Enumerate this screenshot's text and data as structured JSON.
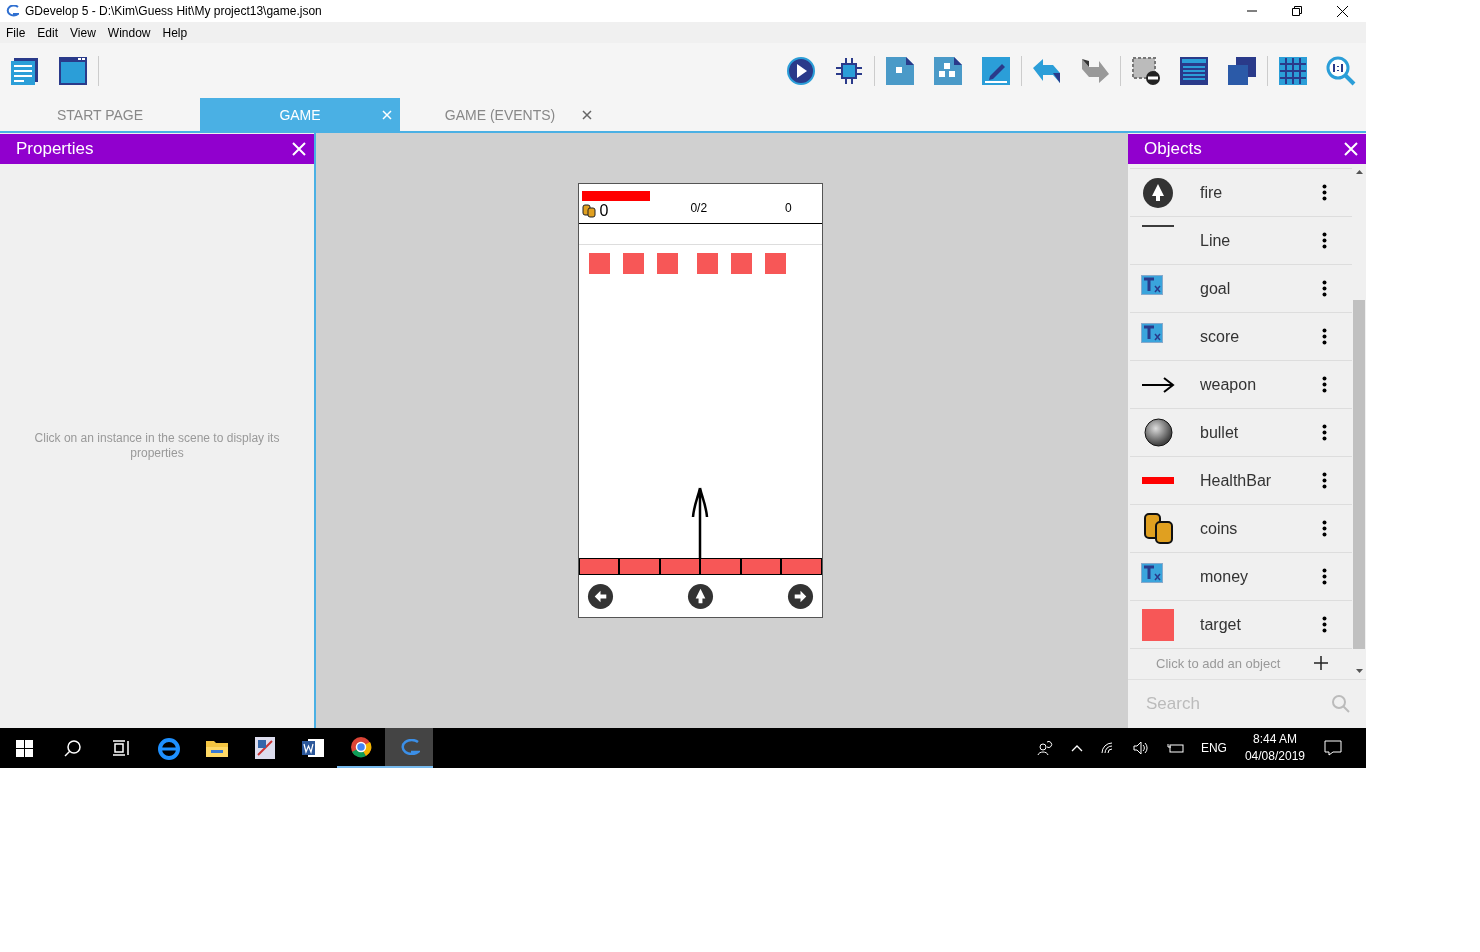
{
  "window": {
    "title": "GDevelop 5 - D:\\Kim\\Guess Hit\\My project13\\game.json"
  },
  "menu": [
    "File",
    "Edit",
    "View",
    "Window",
    "Help"
  ],
  "tabs": [
    {
      "label": "START PAGE",
      "selected": false,
      "closable": false
    },
    {
      "label": "GAME",
      "selected": true,
      "closable": true
    },
    {
      "label": "GAME (EVENTS)",
      "selected": false,
      "closable": true
    }
  ],
  "properties": {
    "title": "Properties",
    "hint": "Click on an instance in the scene to display its properties"
  },
  "scene": {
    "hud": {
      "coins": "0",
      "goal": "0/2",
      "score": "0"
    }
  },
  "objects": {
    "title": "Objects",
    "items": [
      {
        "name": "fire",
        "kind": "button"
      },
      {
        "name": "Line",
        "kind": "line"
      },
      {
        "name": "goal",
        "kind": "text"
      },
      {
        "name": "score",
        "kind": "text"
      },
      {
        "name": "weapon",
        "kind": "arrow"
      },
      {
        "name": "bullet",
        "kind": "ball"
      },
      {
        "name": "HealthBar",
        "kind": "bar"
      },
      {
        "name": "coins",
        "kind": "coins"
      },
      {
        "name": "money",
        "kind": "text"
      },
      {
        "name": "target",
        "kind": "square"
      }
    ],
    "add_hint": "Click to add an object",
    "search": {
      "placeholder": "Search"
    }
  },
  "taskbar": {
    "apps": [
      {
        "kind": "ie",
        "running": false,
        "selected": false
      },
      {
        "kind": "folder",
        "running": false,
        "selected": false
      },
      {
        "kind": "paint",
        "running": false,
        "selected": false
      },
      {
        "kind": "word",
        "running": false,
        "selected": false
      },
      {
        "kind": "chrome",
        "running": true,
        "selected": false
      },
      {
        "kind": "gdevelop",
        "running": true,
        "selected": true
      }
    ],
    "language": "ENG",
    "time": "8:44 AM",
    "date": "04/08/2019"
  }
}
